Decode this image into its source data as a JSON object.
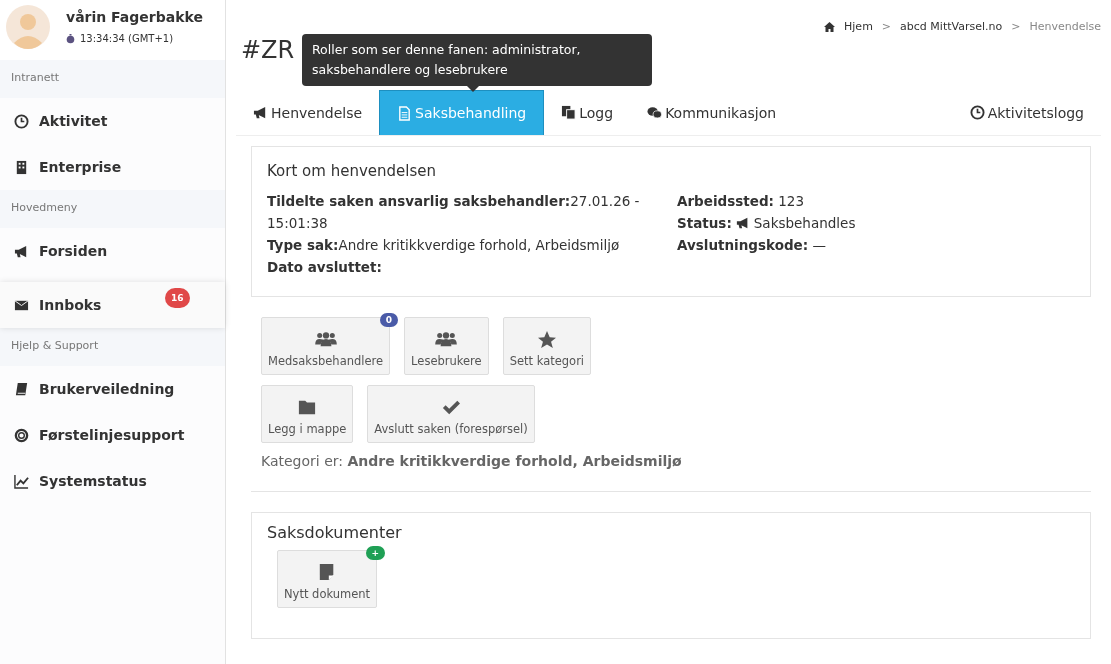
{
  "user": {
    "name": "vårin Fagerbakke",
    "time": "13:34:34 (GMT+1)"
  },
  "sidebar": {
    "items": [
      {
        "kind": "section",
        "label": "Intranett"
      },
      {
        "kind": "item",
        "label": "Aktivitet"
      },
      {
        "kind": "item",
        "label": "Enterprise"
      },
      {
        "kind": "section",
        "label": "Hovedmeny"
      },
      {
        "kind": "item",
        "label": "Forsiden"
      },
      {
        "kind": "card",
        "label": "Innboks",
        "badge": "16"
      },
      {
        "kind": "section",
        "label": "Hjelp & Support"
      },
      {
        "kind": "item",
        "label": "Brukerveiledning"
      },
      {
        "kind": "item",
        "label": "Førstelinjesupport"
      },
      {
        "kind": "item",
        "label": "Systemstatus"
      }
    ]
  },
  "breadcrumb": [
    "Hjem",
    "abcd MittVarsel.no",
    "Henvendelse"
  ],
  "breadcrumb_separator": ">",
  "page_title": "#ZR",
  "tooltip": "Roller som ser denne fanen: administrator, saksbehandlere og lesebrukere",
  "tabs": [
    {
      "label": "Henvendelse",
      "selected": false
    },
    {
      "label": "Saksbehandling",
      "selected": true
    },
    {
      "label": "Logg",
      "selected": false
    },
    {
      "label": "Kommunikasjon",
      "selected": false
    },
    {
      "label": "Aktivitetslogg",
      "selected": false
    }
  ],
  "summary": {
    "title": "Kort om henvendelsen",
    "left": [
      {
        "label": "Tildelte saken ansvarlig saksbehandler:",
        "value": "27.01.26 - 15:01:38"
      },
      {
        "label": "Type sak:",
        "value": "Andre kritikkverdige forhold, Arbeidsmiljø"
      },
      {
        "label": "Dato avsluttet:"
      }
    ],
    "right": [
      {
        "label": "Arbeidssted:",
        "value": "123"
      },
      {
        "label": "Status:",
        "value": "Saksbehandles",
        "kind": "status"
      },
      {
        "label": "Avslutningskode:",
        "value": "—"
      }
    ]
  },
  "actions": [
    [
      {
        "label": "Medsaksbehandlere",
        "badge": "0"
      },
      {
        "label": "Lesebrukere"
      },
      {
        "label": "Sett kategori"
      }
    ],
    [
      {
        "label": "Legg i mappe"
      },
      {
        "label": "Avslutt saken (forespørsel)"
      }
    ]
  ],
  "category": {
    "label": "Kategori er:",
    "value": "Andre kritikkverdige forhold, Arbeidsmiljø"
  },
  "documents": {
    "title": "Saksdokumenter",
    "button": {
      "label": "Nytt dokument",
      "badge": "+"
    }
  }
}
